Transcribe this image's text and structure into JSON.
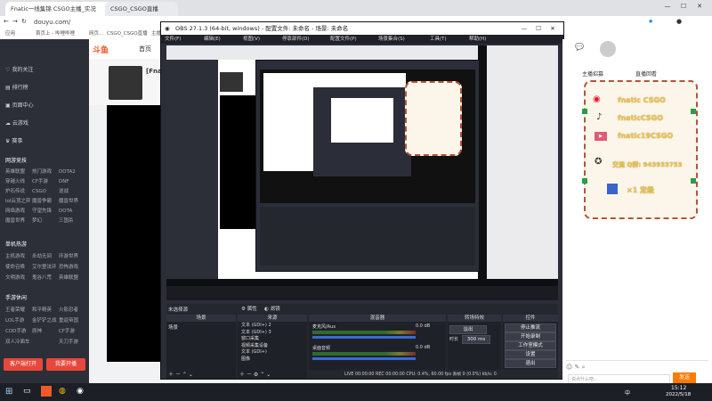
{
  "browser": {
    "tab_title": "Fnatic一线集锦 CSGO主播_实况",
    "tab2_title": "CSGO_CSGO直播",
    "url": "douyu.com/",
    "bookmarks": [
      "应用",
      "首页上 - 哔哩哔哩",
      "网页...",
      "CSGO_CSGO直播",
      "主播中心"
    ]
  },
  "site": {
    "logo_text": "斗鱼",
    "nav_home": "首页",
    "streamer_name": "[Fna"
  },
  "sidebar": {
    "items": [
      {
        "label": "我的关注",
        "icon": "heart-icon"
      },
      {
        "label": "排行榜",
        "icon": "rank-icon"
      },
      {
        "label": "页面中心",
        "icon": "page-icon"
      },
      {
        "label": "云游戏",
        "icon": "cloud-icon"
      }
    ],
    "quick_tabs": [
      "赛事",
      "",
      ""
    ],
    "section_web": "网游竞技",
    "web_games": [
      [
        "英雄联盟",
        "热门游戏",
        "DOTA2"
      ],
      [
        "穿越火线",
        "CF手游",
        "DNF"
      ],
      [
        "炉石传说",
        "CSGO",
        "逆战"
      ],
      [
        "lol云顶之弈",
        "魔兽争霸",
        "魔兽世界"
      ],
      [
        "网络游戏",
        "守望先锋",
        "DOTA"
      ],
      [
        "魔兽世界",
        "梦幻",
        "三国杀"
      ]
    ],
    "section_single": "单机热游",
    "single_games": [
      [
        "主机游戏",
        "永劫无间",
        "环游世界"
      ],
      [
        "使命召唤",
        "艾尔登法环",
        "恐怖游戏"
      ],
      [
        "文明游戏",
        "鬼谷八荒",
        "英雄联盟"
      ]
    ],
    "section_mobile": "手游休闲",
    "mobile_games": [
      [
        "王者荣耀",
        "和平精英",
        "火影忍者"
      ],
      [
        "LOL手游",
        "金铲铲之战",
        "重返帝国"
      ],
      [
        "COD手游",
        "原神",
        "CF手游"
      ],
      [
        "双人冷面车",
        "",
        "天刀手游"
      ]
    ],
    "btn_left": "客户端打开",
    "btn_right": "我要开播"
  },
  "obs": {
    "title": "OBS 27.1.3 (64-bit, windows) - 配置文件: 未命名 - 场景: 未命名",
    "menu": [
      "文件(F)",
      "编辑(E)",
      "视图(V)",
      "停靠部件(D)",
      "配置文件(P)",
      "场景集合(S)",
      "工具(T)",
      "帮助(H)"
    ],
    "no_source": "未选择源",
    "btn_properties": "属性",
    "btn_filters": "滤镜",
    "docks": {
      "scenes": "场景",
      "sources": "来源",
      "mixer": "混音器",
      "transitions": "转场特效",
      "controls": "控件"
    },
    "scenes": [
      "场景"
    ],
    "sources": [
      "文本 (GDI+) 2",
      "文本 (GDI+) 3",
      "窗口采集",
      "视频采集设备",
      "文本 (GDI+)",
      "图像"
    ],
    "mixer": [
      {
        "name": "麦克风/Aux",
        "db": "0.0 dB"
      },
      {
        "name": "桌面音频",
        "db": "0.0 dB"
      }
    ],
    "transition": {
      "type": "淡出",
      "duration_label": "时长",
      "duration": "300 ms"
    },
    "controls": [
      "停止推流",
      "开始录制",
      "工作室模式",
      "设置",
      "退出"
    ],
    "status": {
      "live_label": "LIVE",
      "live_time": "00:00:00",
      "rec_label": "REC",
      "rec_time": "00:00:00",
      "cpu": "CPU: 0.4%, 60.00 fps",
      "kbps": "kb/s: 0",
      "dropped": "丢帧 0 (0.0%)"
    }
  },
  "right": {
    "tab1": "主播招募",
    "tab2": "直播回看",
    "banner_lines": [
      "fnatic CSGO",
      "fnaticCSGO",
      "fnatic19CSGO"
    ],
    "qq": "交流 Q群: 943933753",
    "level_text": "×1 定级",
    "chat_placeholder": "说点什么吧...",
    "send": "发送",
    "login_hint": "主播招募"
  },
  "taskbar": {
    "time": "15:12",
    "date": "2022/5/18",
    "lang": "中"
  }
}
